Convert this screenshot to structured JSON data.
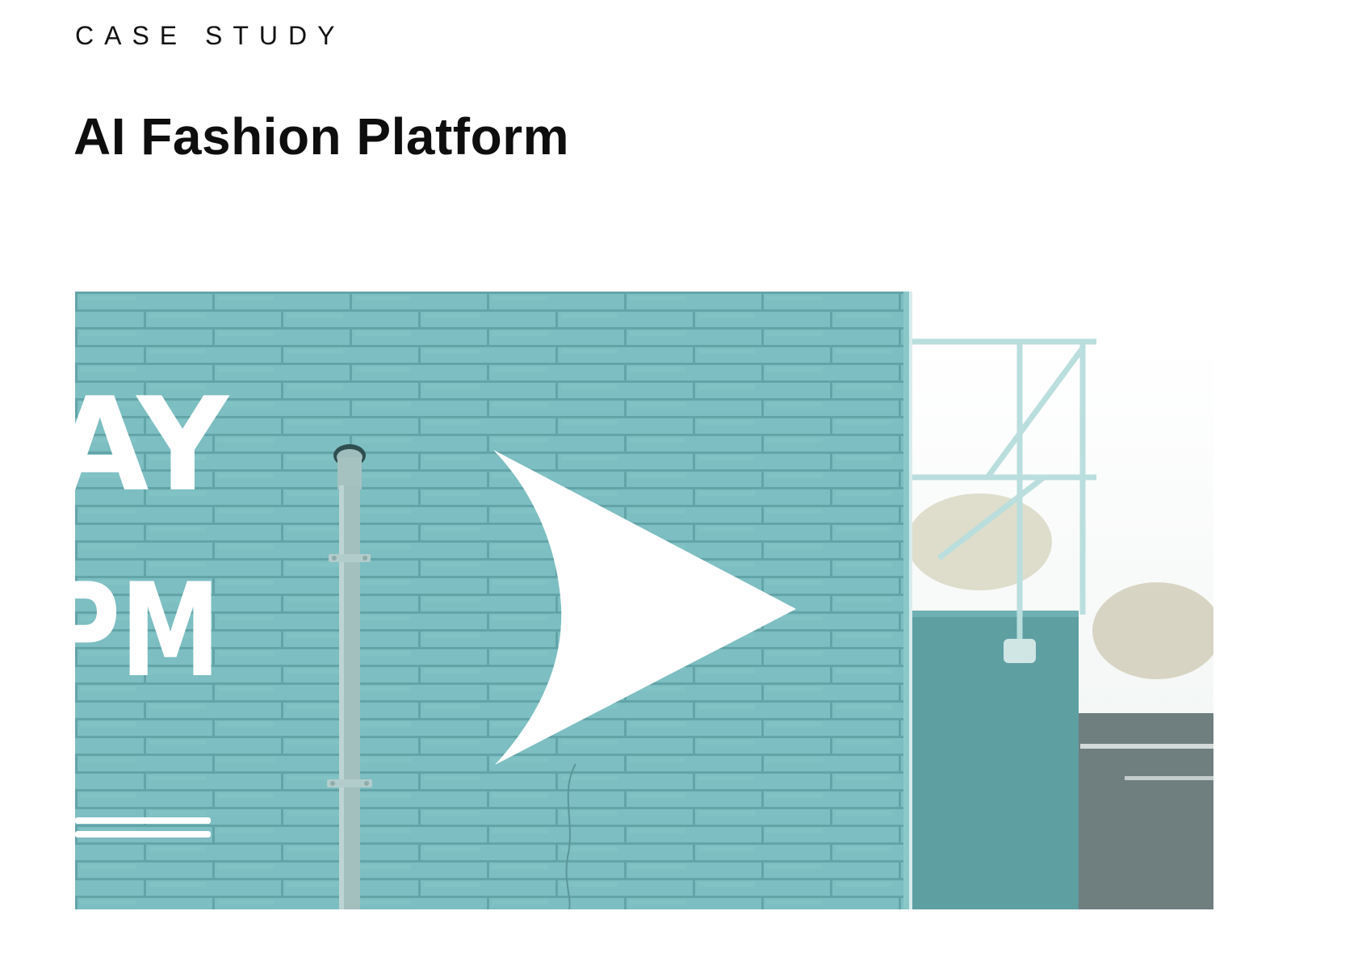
{
  "header": {
    "eyebrow": "CASE STUDY",
    "title": "AI Fashion Platform"
  },
  "hero_image": {
    "alt": "Teal painted brick wall with a white arrow, a drainpipe and partial white lettering",
    "wall_text_line1": "AY",
    "wall_text_line2": "PM",
    "colors": {
      "wall": "#7bbdc0",
      "wall_shadow": "#6aaeb2",
      "mortar": "#5f9fa3",
      "paint": "#ffffff",
      "pipe": "#a7c1c0",
      "background_sky": "#f4f8f6",
      "asphalt": "#6f7f80"
    }
  }
}
